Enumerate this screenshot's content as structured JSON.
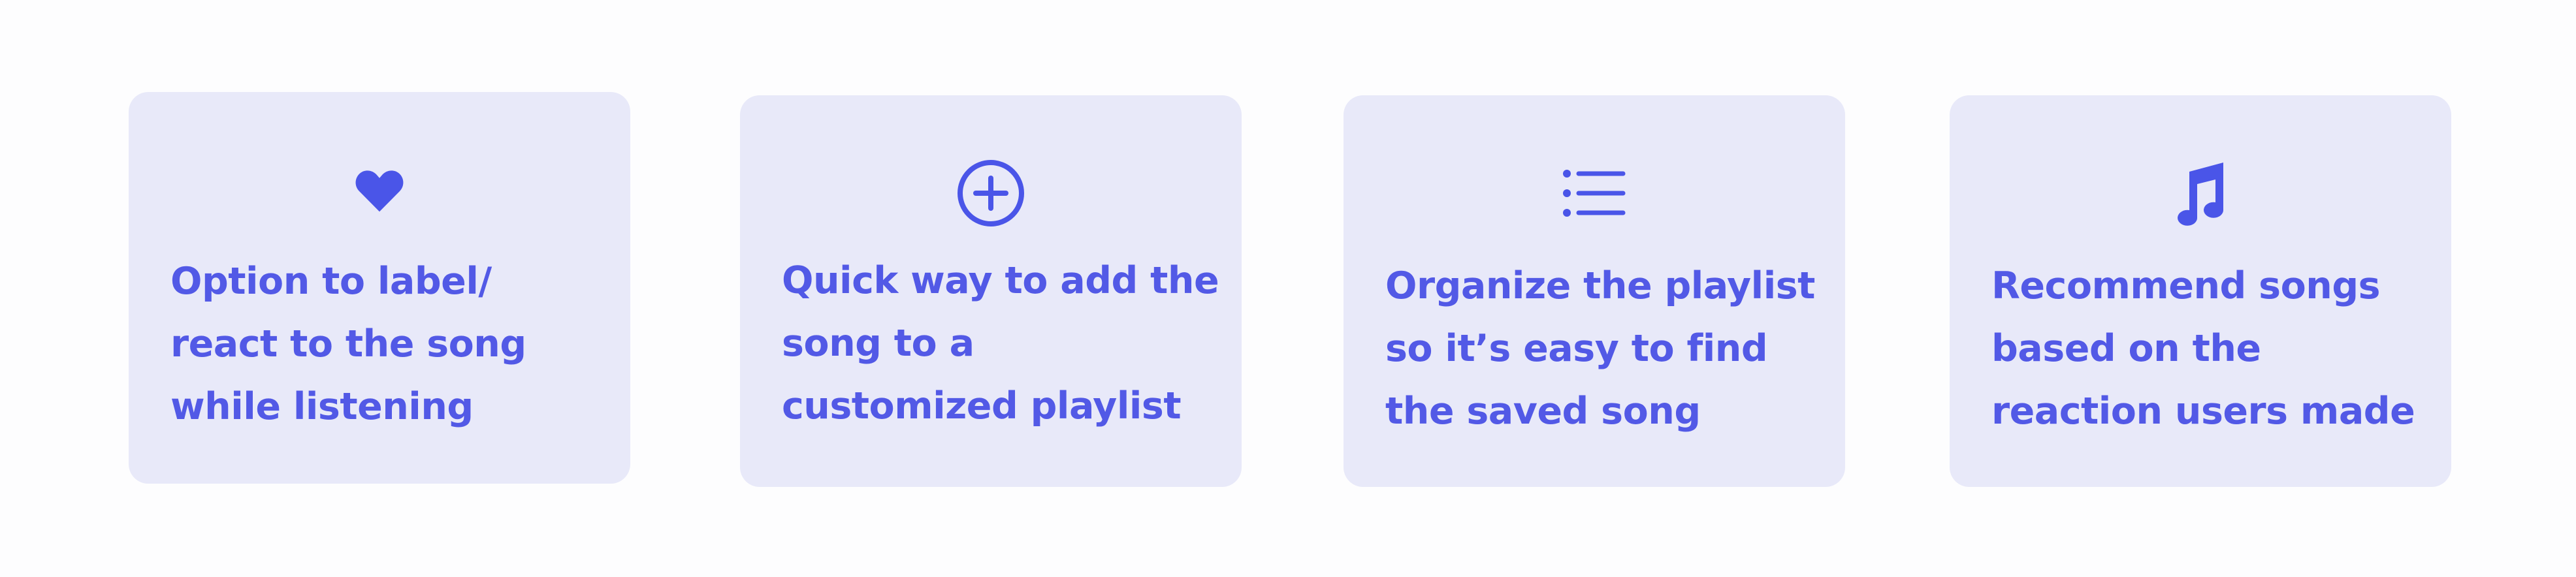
{
  "colors": {
    "accent": "#4a55e8",
    "card_background": "#e8e9f9",
    "page_background": "#fdfdfe"
  },
  "cards": [
    {
      "icon": "heart-icon",
      "text": "Option to label/ react to the song while listening"
    },
    {
      "icon": "plus-circle-icon",
      "text": "Quick way to add the song to a customized playlist"
    },
    {
      "icon": "list-icon",
      "text": "Organize the playlist so it’s easy to find the saved song"
    },
    {
      "icon": "music-note-icon",
      "text": "Recommend songs based on the reaction users made"
    }
  ]
}
